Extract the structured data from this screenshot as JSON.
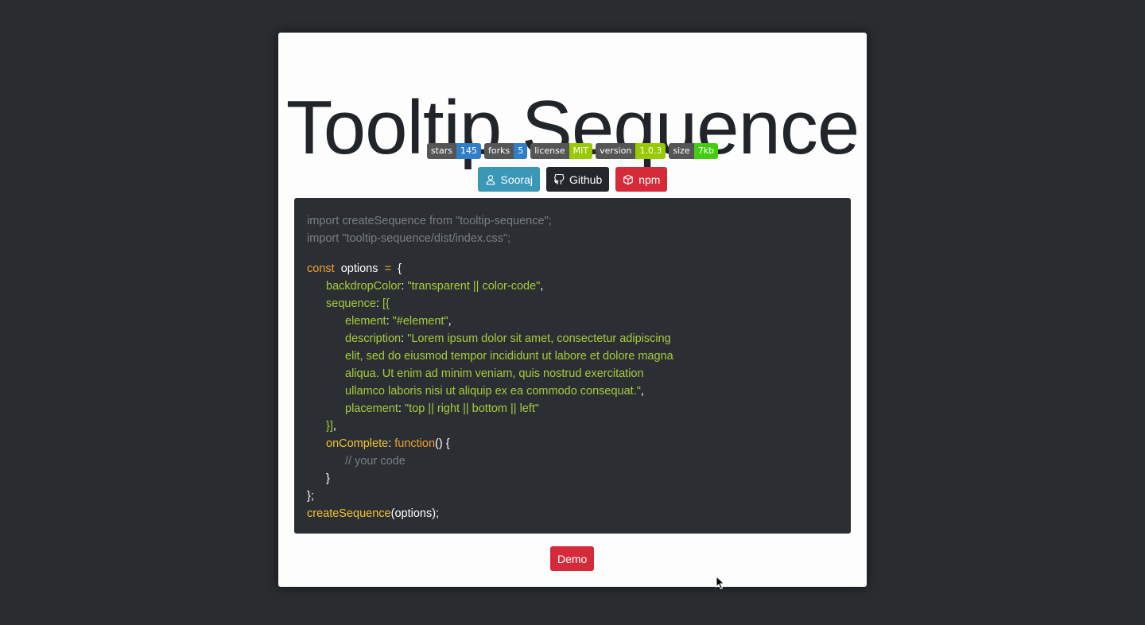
{
  "title": "Tooltip Sequence",
  "badges": [
    {
      "key": "stars",
      "value": "145",
      "color": "#2f7ec7"
    },
    {
      "key": "forks",
      "value": "5",
      "color": "#2f7ec7"
    },
    {
      "key": "license",
      "value": "MIT",
      "color": "#97ca00"
    },
    {
      "key": "version",
      "value": "1.0.3",
      "color": "#97ca00"
    },
    {
      "key": "size",
      "value": "7kb",
      "color": "#4c1"
    }
  ],
  "buttons": {
    "sooraj": {
      "label": "Sooraj",
      "icon": "user-icon"
    },
    "github": {
      "label": "Github",
      "icon": "github-icon"
    },
    "npm": {
      "label": "npm",
      "icon": "package-icon"
    }
  },
  "code": {
    "import1": "import createSequence from \"tooltip-sequence\";",
    "import2": "import \"tooltip-sequence/dist/index.css\";",
    "const_kw": "const",
    "options_var": "options",
    "eq": "=",
    "open_brace": "{",
    "backdrop_key": "backdropColor",
    "backdrop_val": "\"transparent || color-code\"",
    "sequence_key": "sequence",
    "sequence_open": "[{",
    "element_key": "element",
    "element_val": "\"#element\"",
    "description_key": "description",
    "desc_line1": "\"Lorem ipsum dolor sit amet, consectetur adipiscing",
    "desc_line2": "elit, sed do eiusmod tempor incididunt ut labore et dolore magna",
    "desc_line3": "aliqua. Ut enim ad minim veniam, quis nostrud exercitation",
    "desc_line4": "ullamco laboris nisi ut aliquip ex ea commodo consequat.\"",
    "placement_key": "placement",
    "placement_val": "\"top || right || bottom || left\"",
    "sequence_close": "}]",
    "oncomplete_key": "onComplete",
    "function_kw": "function",
    "function_rest": "() {",
    "comment": "// your code",
    "close_fn": "}",
    "close_obj": "};",
    "call_fn": "createSequence",
    "call_args": "(options);"
  },
  "demo_label": "Demo"
}
